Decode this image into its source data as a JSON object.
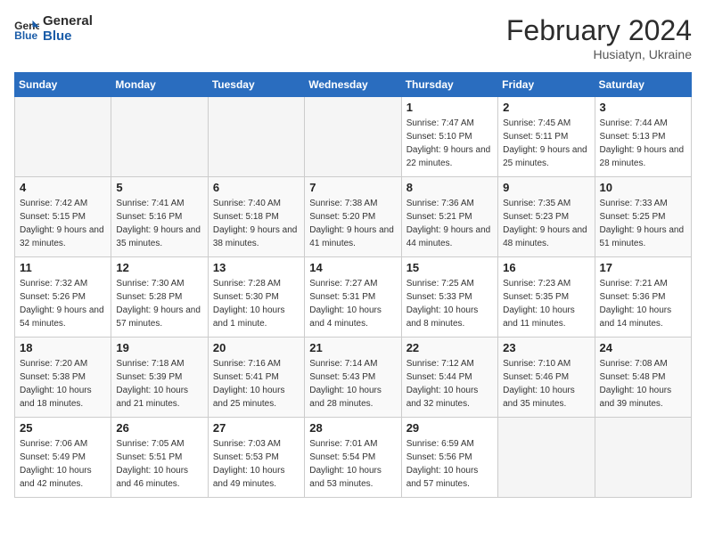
{
  "header": {
    "logo_line1": "General",
    "logo_line2": "Blue",
    "month_title": "February 2024",
    "subtitle": "Husiatyn, Ukraine"
  },
  "days_of_week": [
    "Sunday",
    "Monday",
    "Tuesday",
    "Wednesday",
    "Thursday",
    "Friday",
    "Saturday"
  ],
  "weeks": [
    [
      {
        "day": "",
        "empty": true
      },
      {
        "day": "",
        "empty": true
      },
      {
        "day": "",
        "empty": true
      },
      {
        "day": "",
        "empty": true
      },
      {
        "day": "1",
        "sunrise": "7:47 AM",
        "sunset": "5:10 PM",
        "daylight": "9 hours and 22 minutes."
      },
      {
        "day": "2",
        "sunrise": "7:45 AM",
        "sunset": "5:11 PM",
        "daylight": "9 hours and 25 minutes."
      },
      {
        "day": "3",
        "sunrise": "7:44 AM",
        "sunset": "5:13 PM",
        "daylight": "9 hours and 28 minutes."
      }
    ],
    [
      {
        "day": "4",
        "sunrise": "7:42 AM",
        "sunset": "5:15 PM",
        "daylight": "9 hours and 32 minutes."
      },
      {
        "day": "5",
        "sunrise": "7:41 AM",
        "sunset": "5:16 PM",
        "daylight": "9 hours and 35 minutes."
      },
      {
        "day": "6",
        "sunrise": "7:40 AM",
        "sunset": "5:18 PM",
        "daylight": "9 hours and 38 minutes."
      },
      {
        "day": "7",
        "sunrise": "7:38 AM",
        "sunset": "5:20 PM",
        "daylight": "9 hours and 41 minutes."
      },
      {
        "day": "8",
        "sunrise": "7:36 AM",
        "sunset": "5:21 PM",
        "daylight": "9 hours and 44 minutes."
      },
      {
        "day": "9",
        "sunrise": "7:35 AM",
        "sunset": "5:23 PM",
        "daylight": "9 hours and 48 minutes."
      },
      {
        "day": "10",
        "sunrise": "7:33 AM",
        "sunset": "5:25 PM",
        "daylight": "9 hours and 51 minutes."
      }
    ],
    [
      {
        "day": "11",
        "sunrise": "7:32 AM",
        "sunset": "5:26 PM",
        "daylight": "9 hours and 54 minutes."
      },
      {
        "day": "12",
        "sunrise": "7:30 AM",
        "sunset": "5:28 PM",
        "daylight": "9 hours and 57 minutes."
      },
      {
        "day": "13",
        "sunrise": "7:28 AM",
        "sunset": "5:30 PM",
        "daylight": "10 hours and 1 minute."
      },
      {
        "day": "14",
        "sunrise": "7:27 AM",
        "sunset": "5:31 PM",
        "daylight": "10 hours and 4 minutes."
      },
      {
        "day": "15",
        "sunrise": "7:25 AM",
        "sunset": "5:33 PM",
        "daylight": "10 hours and 8 minutes."
      },
      {
        "day": "16",
        "sunrise": "7:23 AM",
        "sunset": "5:35 PM",
        "daylight": "10 hours and 11 minutes."
      },
      {
        "day": "17",
        "sunrise": "7:21 AM",
        "sunset": "5:36 PM",
        "daylight": "10 hours and 14 minutes."
      }
    ],
    [
      {
        "day": "18",
        "sunrise": "7:20 AM",
        "sunset": "5:38 PM",
        "daylight": "10 hours and 18 minutes."
      },
      {
        "day": "19",
        "sunrise": "7:18 AM",
        "sunset": "5:39 PM",
        "daylight": "10 hours and 21 minutes."
      },
      {
        "day": "20",
        "sunrise": "7:16 AM",
        "sunset": "5:41 PM",
        "daylight": "10 hours and 25 minutes."
      },
      {
        "day": "21",
        "sunrise": "7:14 AM",
        "sunset": "5:43 PM",
        "daylight": "10 hours and 28 minutes."
      },
      {
        "day": "22",
        "sunrise": "7:12 AM",
        "sunset": "5:44 PM",
        "daylight": "10 hours and 32 minutes."
      },
      {
        "day": "23",
        "sunrise": "7:10 AM",
        "sunset": "5:46 PM",
        "daylight": "10 hours and 35 minutes."
      },
      {
        "day": "24",
        "sunrise": "7:08 AM",
        "sunset": "5:48 PM",
        "daylight": "10 hours and 39 minutes."
      }
    ],
    [
      {
        "day": "25",
        "sunrise": "7:06 AM",
        "sunset": "5:49 PM",
        "daylight": "10 hours and 42 minutes."
      },
      {
        "day": "26",
        "sunrise": "7:05 AM",
        "sunset": "5:51 PM",
        "daylight": "10 hours and 46 minutes."
      },
      {
        "day": "27",
        "sunrise": "7:03 AM",
        "sunset": "5:53 PM",
        "daylight": "10 hours and 49 minutes."
      },
      {
        "day": "28",
        "sunrise": "7:01 AM",
        "sunset": "5:54 PM",
        "daylight": "10 hours and 53 minutes."
      },
      {
        "day": "29",
        "sunrise": "6:59 AM",
        "sunset": "5:56 PM",
        "daylight": "10 hours and 57 minutes."
      },
      {
        "day": "",
        "empty": true
      },
      {
        "day": "",
        "empty": true
      }
    ]
  ],
  "labels": {
    "sunrise": "Sunrise:",
    "sunset": "Sunset:",
    "daylight": "Daylight:"
  }
}
